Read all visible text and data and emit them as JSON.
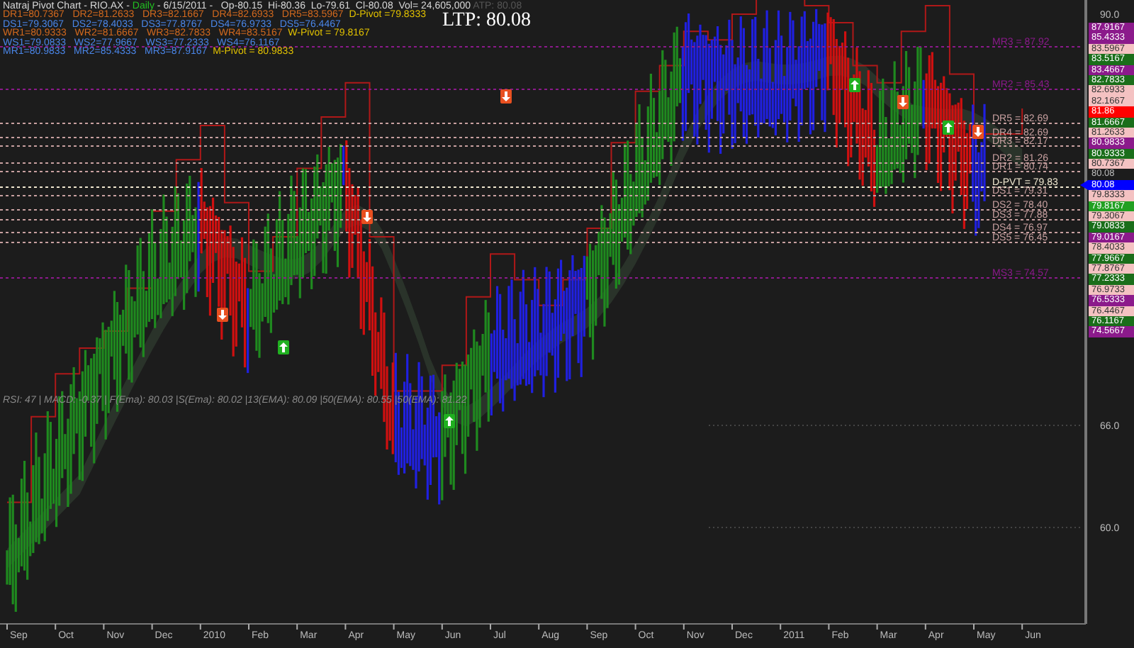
{
  "header": {
    "lines": [
      [
        {
          "text": "Natraj Pivot Chart - RIO.AX - ",
          "color": "#d8d8d8"
        },
        {
          "text": "Daily",
          "color": "#22c022"
        },
        {
          "text": " - 6/15/2011 -   Op-80.15  Hi-80.36  Lo-79.61  Cl-80.08  Vol= 24,605,000",
          "color": "#d8d8d8"
        },
        {
          "text": " ATP: 80.08",
          "color": "#555555"
        }
      ],
      [
        {
          "text": "DR1=80.7367   DR2=81.2633   DR3=82.1667   DR4=82.6933   DR5=83.5967",
          "color": "#d2691e"
        },
        {
          "text": "  D-Pivot =79.8333",
          "color": "#e0c000"
        }
      ],
      [
        {
          "text": "DS1=79.3067   DS2=78.4033   DS3=77.8767   DS4=76.9733   DS5=76.4467",
          "color": "#4a86e8"
        }
      ],
      [
        {
          "text": "WR1=80.9333   WR2=81.6667   WR3=82.7833   WR4=83.5167",
          "color": "#d2691e"
        },
        {
          "text": "  W-Pivot = 79.8167",
          "color": "#e0c000"
        }
      ],
      [
        {
          "text": "WS1=79.0833   WS2=77.9667   WS3=77.2333   WS4=76.1167",
          "color": "#4a86e8"
        }
      ],
      [
        {
          "text": "MR1=80.9833   MR2=85.4333   MR3=87.9167",
          "color": "#4a86e8"
        },
        {
          "text": "  M-Pivot = 80.9833",
          "color": "#e0c000"
        }
      ]
    ],
    "ltp": "LTP: 80.08"
  },
  "indicators": "RSI: 47 | MACD: -0.37 | F(Ema): 80.03 |S(Ema): 80.02 |13(EMA): 80.09 |50(EMA): 80.55 |50(EMA): 81.22",
  "price_labels": [
    {
      "text": "87.9167",
      "kind": "tag",
      "color": "#8b1a8b"
    },
    {
      "text": "85.4333",
      "kind": "tag",
      "color": "#8b1a8b"
    },
    {
      "text": "83.5967",
      "kind": "tag",
      "color": "#f4c2c2"
    },
    {
      "text": "83.5167",
      "kind": "tag",
      "color": "#1a6e1a"
    },
    {
      "text": "83.4667",
      "kind": "tag",
      "color": "#8b1a8b"
    },
    {
      "text": "82.7833",
      "kind": "tag",
      "color": "#1a6e1a"
    },
    {
      "text": "82.6933",
      "kind": "tag",
      "color": "#f4c2c2"
    },
    {
      "text": "82.1667",
      "kind": "tag",
      "color": "#f4c2c2"
    },
    {
      "text": "81.86",
      "kind": "tag",
      "color": "#ff0000"
    },
    {
      "text": "81.6667",
      "kind": "tag",
      "color": "#1a6e1a"
    },
    {
      "text": "81.2633",
      "kind": "tag",
      "color": "#f4c2c2"
    },
    {
      "text": "80.9833",
      "kind": "tag",
      "color": "#8b1a8b"
    },
    {
      "text": "80.9333",
      "kind": "tag",
      "color": "#1a6e1a"
    },
    {
      "text": "80.7367",
      "kind": "tag",
      "color": "#f4c2c2"
    },
    {
      "text": "80.08",
      "kind": "plain",
      "color": "#1c1c1c"
    },
    {
      "text": "80.08",
      "kind": "pointer",
      "color": "#0000ff"
    },
    {
      "text": "79.8333",
      "kind": "tag",
      "color": "#f4c2c2"
    },
    {
      "text": "79.8167",
      "kind": "tag",
      "color": "#22a022"
    },
    {
      "text": "79.3067",
      "kind": "tag",
      "color": "#f4c2c2"
    },
    {
      "text": "79.0833",
      "kind": "tag",
      "color": "#1a6e1a"
    },
    {
      "text": "79.0167",
      "kind": "tag",
      "color": "#8b1a8b"
    },
    {
      "text": "78.4033",
      "kind": "tag",
      "color": "#f4c2c2"
    },
    {
      "text": "77.9667",
      "kind": "tag",
      "color": "#1a6e1a"
    },
    {
      "text": "77.8767",
      "kind": "tag",
      "color": "#f4c2c2"
    },
    {
      "text": "77.2333",
      "kind": "tag",
      "color": "#1a6e1a"
    },
    {
      "text": "76.9733",
      "kind": "tag",
      "color": "#f4c2c2"
    },
    {
      "text": "76.5333",
      "kind": "tag",
      "color": "#8b1a8b"
    },
    {
      "text": "76.4467",
      "kind": "tag",
      "color": "#f4c2c2"
    },
    {
      "text": "76.1167",
      "kind": "tag",
      "color": "#1a6e1a"
    },
    {
      "text": "74.5667",
      "kind": "tag",
      "color": "#8b1a8b"
    }
  ],
  "y_axis_labels": [
    "90.0",
    "66.0",
    "60.0"
  ],
  "x_axis_labels": [
    "Sep",
    "Oct",
    "Nov",
    "Dec",
    "2010",
    "Feb",
    "Mar",
    "Apr",
    "May",
    "Jun",
    "Jul",
    "Aug",
    "Sep",
    "Oct",
    "Nov",
    "Dec",
    "2011",
    "Feb",
    "Mar",
    "Apr",
    "May",
    "Jun"
  ],
  "pivot_lines": [
    {
      "label": "MR3 = 87.92",
      "color": "#8b1a8b"
    },
    {
      "label": "MR2 = 85.43",
      "color": "#8b1a8b"
    },
    {
      "label": "DR5 = 82.69",
      "color": "#c8a0a0"
    },
    {
      "label": "DR4 = 82.69",
      "color": "#c8a0a0"
    },
    {
      "label": "DR3 = 82.17",
      "color": "#c8a0a0"
    },
    {
      "label": "DR2 = 81.26",
      "color": "#c8a0a0"
    },
    {
      "label": "DR1 = 80.74",
      "color": "#c8a0a0"
    },
    {
      "label": "D-PVT = 79.83",
      "color": "#f0e8d0"
    },
    {
      "label": "DS1 = 79.31",
      "color": "#c8a0a0"
    },
    {
      "label": "DS2 = 78.40",
      "color": "#c8a0a0"
    },
    {
      "label": "DS3 = 77.88",
      "color": "#c8a0a0"
    },
    {
      "label": "DS4 = 76.97",
      "color": "#c8a0a0"
    },
    {
      "label": "DS5 = 76.45",
      "color": "#c8a0a0"
    },
    {
      "label": "MS3 = 74.57",
      "color": "#8b1a8b"
    }
  ],
  "signals": [
    {
      "kind": "sell"
    },
    {
      "kind": "buy"
    },
    {
      "kind": "sell"
    },
    {
      "kind": "buy"
    },
    {
      "kind": "sell"
    },
    {
      "kind": "buy"
    },
    {
      "kind": "sell"
    },
    {
      "kind": "buy"
    },
    {
      "kind": "sell"
    }
  ]
}
